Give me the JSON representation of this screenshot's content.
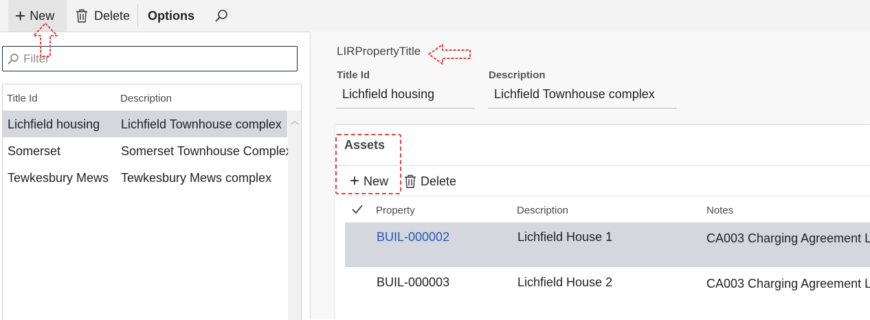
{
  "toolbar": {
    "new_label": "New",
    "delete_label": "Delete",
    "options_label": "Options"
  },
  "filter": {
    "placeholder": "Filter"
  },
  "left_grid": {
    "columns": [
      "Title Id",
      "Description"
    ],
    "rows": [
      {
        "title_id": "Lichfield housing",
        "description": "Lichfield Townhouse complex",
        "selected": true
      },
      {
        "title_id": "Somerset",
        "description": "Somerset Townhouse Complex",
        "selected": false
      },
      {
        "title_id": "Tewkesbury Mews",
        "description": "Tewkesbury Mews complex",
        "selected": false
      }
    ]
  },
  "form": {
    "title": "LIRPropertyTitle",
    "title_id_label": "Title Id",
    "title_id_value": "Lichfield housing",
    "description_label": "Description",
    "description_value": "Lichfield Townhouse complex"
  },
  "assets": {
    "title": "Assets",
    "new_label": "New",
    "delete_label": "Delete",
    "columns": [
      "Property",
      "Description",
      "Notes"
    ],
    "rows": [
      {
        "property": "BUIL-000002",
        "description": "Lichfield House 1",
        "notes": "CA003 Charging Agreement L",
        "selected": true
      },
      {
        "property": "BUIL-000003",
        "description": "Lichfield House 2",
        "notes": "CA003 Charging Agreement L",
        "selected": false
      }
    ]
  },
  "colors": {
    "annotation": "#e4403f",
    "selected_row": "#d4d7de",
    "link": "#2659b5"
  }
}
